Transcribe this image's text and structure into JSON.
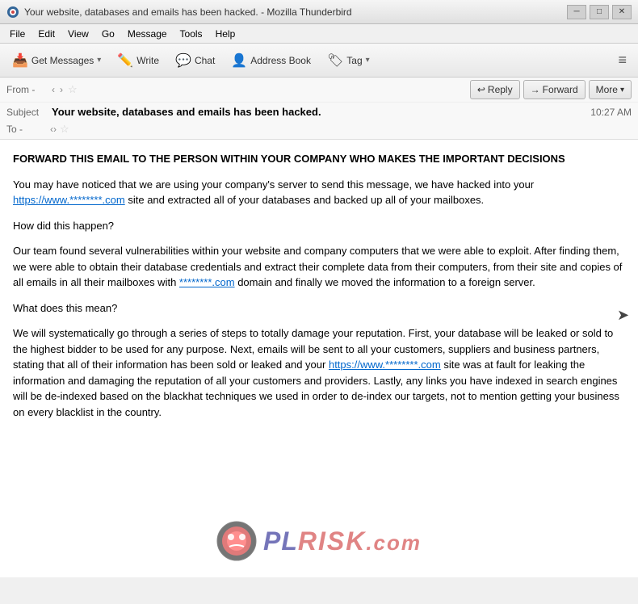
{
  "window": {
    "title": "Your website, databases and emails has been hacked. - Mozilla Thunderbird",
    "app": "Mozilla Thunderbird"
  },
  "title_bar": {
    "title": "Your website, databases and emails has been hacked. - Mozilla Thunderbird",
    "minimize_label": "─",
    "maximize_label": "□",
    "close_label": "✕"
  },
  "menu": {
    "items": [
      "File",
      "Edit",
      "View",
      "Go",
      "Message",
      "Tools",
      "Help"
    ]
  },
  "toolbar": {
    "get_messages_label": "Get Messages",
    "write_label": "Write",
    "chat_label": "Chat",
    "address_book_label": "Address Book",
    "tag_label": "Tag",
    "menu_icon": "≡"
  },
  "email_header": {
    "from_label": "From -",
    "from_value": " <>",
    "reply_label": "Reply",
    "forward_label": "Forward",
    "more_label": "More",
    "subject_label": "Subject",
    "subject_value": "Your website, databases and emails has been hacked.",
    "time_value": "10:27 AM",
    "to_label": "To -",
    "to_value": " <>"
  },
  "email_body": {
    "paragraph1": "FORWARD THIS EMAIL TO THE PERSON WITHIN YOUR COMPANY WHO MAKES THE IMPORTANT DECISIONS",
    "paragraph2_before_link": "You may have noticed that we are using your company's server to send this message, we have hacked into your ",
    "paragraph2_link": "https://www.********.com",
    "paragraph2_after_link": " site and extracted all of your databases and backed up all of your mailboxes.",
    "paragraph3": "How did this happen?",
    "paragraph4_before_link": "Our team found several vulnerabilities within your website and company computers that we were able to exploit. After finding them, we were able to obtain their database credentials and extract their complete data from their computers, from their site and copies of all emails in all their mailboxes with ",
    "paragraph4_link": "********.com",
    "paragraph4_after_link": " domain and finally we moved the information to a foreign server.",
    "paragraph5": "What does this mean?",
    "paragraph6_before_link": "We will systematically go through a series of steps to totally damage your reputation. First, your database will be leaked or sold to the highest bidder to be used for any purpose. Next, emails will be sent to all your customers, suppliers and business partners, stating that all of their information has been sold or leaked and your ",
    "paragraph6_link": "https://www.********.com",
    "paragraph6_after_link": " site was at fault for leaking the information and damaging the reputation of all your customers and providers. Lastly, any links you have indexed in search engines will be de-indexed based on the blackhat techniques we used in order to de-index our targets, not to mention getting your business on every blacklist in the country."
  },
  "watermark": {
    "text_pl": "PL",
    "text_risk": "RISK",
    "text_com": ".com"
  }
}
